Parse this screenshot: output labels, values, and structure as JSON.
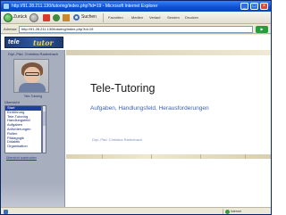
{
  "window": {
    "title": "http://91.28.211.130/tutoring/index.php?id=19 - Microsoft Internet Explorer"
  },
  "toolbar": {
    "back_label": "Zurück",
    "search_label": "Suchen",
    "items": [
      "Favoriten",
      "Medien",
      "Verlauf",
      "Senden",
      "Drucken"
    ]
  },
  "address": {
    "label": "Adresse",
    "value": "http://91.28.211.130/tutoring/index.php?id=19",
    "go_label": "Wechseln zu"
  },
  "logo": {
    "main": "tele",
    "accent": "tutor"
  },
  "sidebar": {
    "title": "Dipl.-Päd. Christina Radenbach",
    "caption": "Tele-Tutoring",
    "menu_heading": "Übersicht",
    "items": [
      {
        "label": "Start"
      },
      {
        "label": "Einführung"
      },
      {
        "label": "Tele-Tutoring"
      },
      {
        "label": "Handlungsfeld"
      },
      {
        "label": "Aufgaben"
      },
      {
        "label": "Anforderungen"
      },
      {
        "label": "Rollen"
      },
      {
        "label": "Pädagogik"
      },
      {
        "label": "Didaktik"
      },
      {
        "label": "Organisation"
      }
    ],
    "link": "Übersicht ausdrucken"
  },
  "main": {
    "title": "Tele-Tutoring",
    "subtitle": "Aufgaben, Handlungsfeld, Herausforderungen",
    "author": "Dipl.-Päd. Christina Radenbach"
  },
  "status": {
    "zone": "Internet"
  },
  "colors": {
    "titlebar": "#0b4fd6",
    "sidebar": "#a7aebe",
    "subtitle": "#3d5fb0",
    "menu_selected": "#1e3f9e"
  }
}
